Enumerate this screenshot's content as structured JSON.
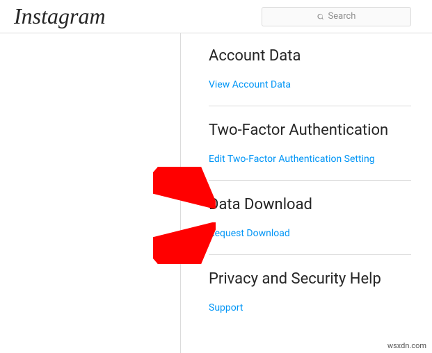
{
  "header": {
    "brand": "Instagram",
    "search_placeholder": "Search"
  },
  "sections": {
    "account_data": {
      "title": "Account Data",
      "link_label": "View Account Data"
    },
    "two_factor": {
      "title": "Two-Factor Authentication",
      "link_label": "Edit Two-Factor Authentication Setting"
    },
    "data_download": {
      "title": "Data Download",
      "link_label": "Request Download"
    },
    "privacy_help": {
      "title": "Privacy and Security Help",
      "link_label": "Support"
    }
  },
  "watermark": "wsxdn.com"
}
